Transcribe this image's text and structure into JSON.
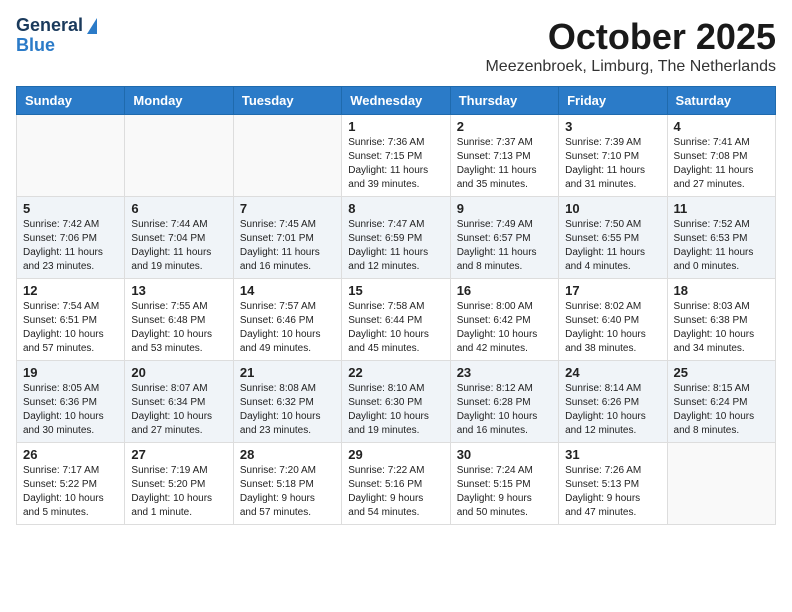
{
  "header": {
    "logo_line1": "General",
    "logo_line2": "Blue",
    "month_title": "October 2025",
    "location": "Meezenbroek, Limburg, The Netherlands"
  },
  "weekdays": [
    "Sunday",
    "Monday",
    "Tuesday",
    "Wednesday",
    "Thursday",
    "Friday",
    "Saturday"
  ],
  "weeks": [
    [
      {
        "day": "",
        "info": ""
      },
      {
        "day": "",
        "info": ""
      },
      {
        "day": "",
        "info": ""
      },
      {
        "day": "1",
        "info": "Sunrise: 7:36 AM\nSunset: 7:15 PM\nDaylight: 11 hours\nand 39 minutes."
      },
      {
        "day": "2",
        "info": "Sunrise: 7:37 AM\nSunset: 7:13 PM\nDaylight: 11 hours\nand 35 minutes."
      },
      {
        "day": "3",
        "info": "Sunrise: 7:39 AM\nSunset: 7:10 PM\nDaylight: 11 hours\nand 31 minutes."
      },
      {
        "day": "4",
        "info": "Sunrise: 7:41 AM\nSunset: 7:08 PM\nDaylight: 11 hours\nand 27 minutes."
      }
    ],
    [
      {
        "day": "5",
        "info": "Sunrise: 7:42 AM\nSunset: 7:06 PM\nDaylight: 11 hours\nand 23 minutes."
      },
      {
        "day": "6",
        "info": "Sunrise: 7:44 AM\nSunset: 7:04 PM\nDaylight: 11 hours\nand 19 minutes."
      },
      {
        "day": "7",
        "info": "Sunrise: 7:45 AM\nSunset: 7:01 PM\nDaylight: 11 hours\nand 16 minutes."
      },
      {
        "day": "8",
        "info": "Sunrise: 7:47 AM\nSunset: 6:59 PM\nDaylight: 11 hours\nand 12 minutes."
      },
      {
        "day": "9",
        "info": "Sunrise: 7:49 AM\nSunset: 6:57 PM\nDaylight: 11 hours\nand 8 minutes."
      },
      {
        "day": "10",
        "info": "Sunrise: 7:50 AM\nSunset: 6:55 PM\nDaylight: 11 hours\nand 4 minutes."
      },
      {
        "day": "11",
        "info": "Sunrise: 7:52 AM\nSunset: 6:53 PM\nDaylight: 11 hours\nand 0 minutes."
      }
    ],
    [
      {
        "day": "12",
        "info": "Sunrise: 7:54 AM\nSunset: 6:51 PM\nDaylight: 10 hours\nand 57 minutes."
      },
      {
        "day": "13",
        "info": "Sunrise: 7:55 AM\nSunset: 6:48 PM\nDaylight: 10 hours\nand 53 minutes."
      },
      {
        "day": "14",
        "info": "Sunrise: 7:57 AM\nSunset: 6:46 PM\nDaylight: 10 hours\nand 49 minutes."
      },
      {
        "day": "15",
        "info": "Sunrise: 7:58 AM\nSunset: 6:44 PM\nDaylight: 10 hours\nand 45 minutes."
      },
      {
        "day": "16",
        "info": "Sunrise: 8:00 AM\nSunset: 6:42 PM\nDaylight: 10 hours\nand 42 minutes."
      },
      {
        "day": "17",
        "info": "Sunrise: 8:02 AM\nSunset: 6:40 PM\nDaylight: 10 hours\nand 38 minutes."
      },
      {
        "day": "18",
        "info": "Sunrise: 8:03 AM\nSunset: 6:38 PM\nDaylight: 10 hours\nand 34 minutes."
      }
    ],
    [
      {
        "day": "19",
        "info": "Sunrise: 8:05 AM\nSunset: 6:36 PM\nDaylight: 10 hours\nand 30 minutes."
      },
      {
        "day": "20",
        "info": "Sunrise: 8:07 AM\nSunset: 6:34 PM\nDaylight: 10 hours\nand 27 minutes."
      },
      {
        "day": "21",
        "info": "Sunrise: 8:08 AM\nSunset: 6:32 PM\nDaylight: 10 hours\nand 23 minutes."
      },
      {
        "day": "22",
        "info": "Sunrise: 8:10 AM\nSunset: 6:30 PM\nDaylight: 10 hours\nand 19 minutes."
      },
      {
        "day": "23",
        "info": "Sunrise: 8:12 AM\nSunset: 6:28 PM\nDaylight: 10 hours\nand 16 minutes."
      },
      {
        "day": "24",
        "info": "Sunrise: 8:14 AM\nSunset: 6:26 PM\nDaylight: 10 hours\nand 12 minutes."
      },
      {
        "day": "25",
        "info": "Sunrise: 8:15 AM\nSunset: 6:24 PM\nDaylight: 10 hours\nand 8 minutes."
      }
    ],
    [
      {
        "day": "26",
        "info": "Sunrise: 7:17 AM\nSunset: 5:22 PM\nDaylight: 10 hours\nand 5 minutes."
      },
      {
        "day": "27",
        "info": "Sunrise: 7:19 AM\nSunset: 5:20 PM\nDaylight: 10 hours\nand 1 minute."
      },
      {
        "day": "28",
        "info": "Sunrise: 7:20 AM\nSunset: 5:18 PM\nDaylight: 9 hours\nand 57 minutes."
      },
      {
        "day": "29",
        "info": "Sunrise: 7:22 AM\nSunset: 5:16 PM\nDaylight: 9 hours\nand 54 minutes."
      },
      {
        "day": "30",
        "info": "Sunrise: 7:24 AM\nSunset: 5:15 PM\nDaylight: 9 hours\nand 50 minutes."
      },
      {
        "day": "31",
        "info": "Sunrise: 7:26 AM\nSunset: 5:13 PM\nDaylight: 9 hours\nand 47 minutes."
      },
      {
        "day": "",
        "info": ""
      }
    ]
  ]
}
